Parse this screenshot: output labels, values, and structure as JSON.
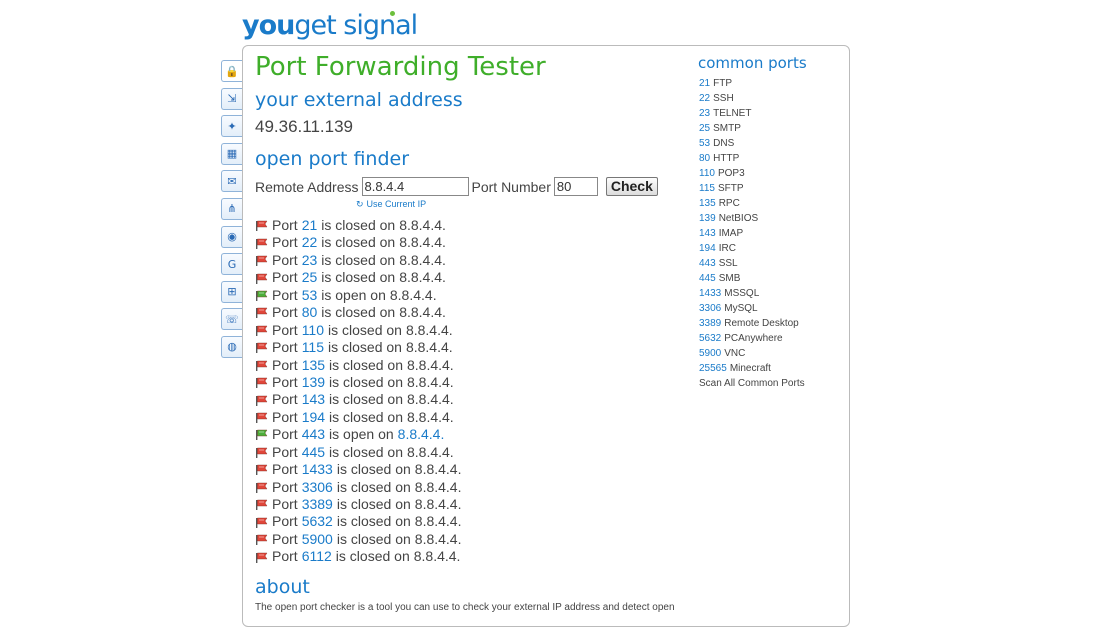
{
  "site": {
    "logo_you": "you",
    "logo_rest": "get signal"
  },
  "tools": [
    {
      "icon": "lock-icon",
      "glyph": "🔒"
    },
    {
      "icon": "trace-icon",
      "glyph": "⇲"
    },
    {
      "icon": "location-icon",
      "glyph": "✦"
    },
    {
      "icon": "calendar-icon",
      "glyph": "▦"
    },
    {
      "icon": "mail-icon",
      "glyph": "✉"
    },
    {
      "icon": "network-icon",
      "glyph": "⋔"
    },
    {
      "icon": "whois-icon",
      "glyph": "◉"
    },
    {
      "icon": "google-icon",
      "glyph": "G"
    },
    {
      "icon": "windows-icon",
      "glyph": "⊞"
    },
    {
      "icon": "phone-icon",
      "glyph": "☏"
    },
    {
      "icon": "globe-icon",
      "glyph": "◍"
    }
  ],
  "page": {
    "title": "Port Forwarding Tester",
    "external_heading": "your external address",
    "external_ip": "49.36.11.139",
    "finder_heading": "open port finder",
    "remote_label": "Remote Address",
    "remote_value": "8.8.4.4",
    "port_label": "Port Number",
    "port_value": "80",
    "check_label": "Check",
    "use_current_ip": "Use Current IP",
    "about_heading": "about",
    "about_text": "The open port checker is a tool you can use to check your external IP address and detect open"
  },
  "results": [
    {
      "status": "closed",
      "prefix": "Port",
      "port": "21",
      "verb": "is closed on",
      "ip": "8.8.4.4."
    },
    {
      "status": "closed",
      "prefix": "Port",
      "port": "22",
      "verb": "is closed on",
      "ip": "8.8.4.4."
    },
    {
      "status": "closed",
      "prefix": "Port",
      "port": "23",
      "verb": "is closed on",
      "ip": "8.8.4.4."
    },
    {
      "status": "closed",
      "prefix": "Port",
      "port": "25",
      "verb": "is closed on",
      "ip": "8.8.4.4."
    },
    {
      "status": "open",
      "prefix": "Port",
      "port": "53",
      "verb": "is open on",
      "ip": "8.8.4.4."
    },
    {
      "status": "closed",
      "prefix": "Port",
      "port": "80",
      "verb": "is closed on",
      "ip": "8.8.4.4."
    },
    {
      "status": "closed",
      "prefix": "Port",
      "port": "110",
      "verb": "is closed on",
      "ip": "8.8.4.4."
    },
    {
      "status": "closed",
      "prefix": "Port",
      "port": "115",
      "verb": "is closed on",
      "ip": "8.8.4.4."
    },
    {
      "status": "closed",
      "prefix": "Port",
      "port": "135",
      "verb": "is closed on",
      "ip": "8.8.4.4."
    },
    {
      "status": "closed",
      "prefix": "Port",
      "port": "139",
      "verb": "is closed on",
      "ip": "8.8.4.4."
    },
    {
      "status": "closed",
      "prefix": "Port",
      "port": "143",
      "verb": "is closed on",
      "ip": "8.8.4.4."
    },
    {
      "status": "closed",
      "prefix": "Port",
      "port": "194",
      "verb": "is closed on",
      "ip": "8.8.4.4."
    },
    {
      "status": "open",
      "prefix": "Port",
      "port": "443",
      "verb": "is open on",
      "ip": "8.8.4.4.",
      "ip_link": true
    },
    {
      "status": "closed",
      "prefix": "Port",
      "port": "445",
      "verb": "is closed on",
      "ip": "8.8.4.4."
    },
    {
      "status": "closed",
      "prefix": "Port",
      "port": "1433",
      "verb": "is closed on",
      "ip": "8.8.4.4."
    },
    {
      "status": "closed",
      "prefix": "Port",
      "port": "3306",
      "verb": "is closed on",
      "ip": "8.8.4.4."
    },
    {
      "status": "closed",
      "prefix": "Port",
      "port": "3389",
      "verb": "is closed on",
      "ip": "8.8.4.4."
    },
    {
      "status": "closed",
      "prefix": "Port",
      "port": "5632",
      "verb": "is closed on",
      "ip": "8.8.4.4."
    },
    {
      "status": "closed",
      "prefix": "Port",
      "port": "5900",
      "verb": "is closed on",
      "ip": "8.8.4.4."
    },
    {
      "status": "closed",
      "prefix": "Port",
      "port": "6112",
      "verb": "is closed on",
      "ip": "8.8.4.4."
    }
  ],
  "common_ports": {
    "title": "common ports",
    "items": [
      {
        "port": "21",
        "name": "FTP"
      },
      {
        "port": "22",
        "name": "SSH"
      },
      {
        "port": "23",
        "name": "TELNET"
      },
      {
        "port": "25",
        "name": "SMTP"
      },
      {
        "port": "53",
        "name": "DNS"
      },
      {
        "port": "80",
        "name": "HTTP"
      },
      {
        "port": "110",
        "name": "POP3"
      },
      {
        "port": "115",
        "name": "SFTP"
      },
      {
        "port": "135",
        "name": "RPC"
      },
      {
        "port": "139",
        "name": "NetBIOS"
      },
      {
        "port": "143",
        "name": "IMAP"
      },
      {
        "port": "194",
        "name": "IRC"
      },
      {
        "port": "443",
        "name": "SSL"
      },
      {
        "port": "445",
        "name": "SMB"
      },
      {
        "port": "1433",
        "name": "MSSQL"
      },
      {
        "port": "3306",
        "name": "MySQL"
      },
      {
        "port": "3389",
        "name": "Remote Desktop"
      },
      {
        "port": "5632",
        "name": "PCAnywhere"
      },
      {
        "port": "5900",
        "name": "VNC"
      },
      {
        "port": "25565",
        "name": "Minecraft"
      }
    ],
    "scan_all": "Scan All Common Ports"
  },
  "colors": {
    "closed_flag": "#e0463a",
    "open_flag": "#4cae3a",
    "link": "#1a7bc9",
    "title_green": "#3fae2a"
  }
}
